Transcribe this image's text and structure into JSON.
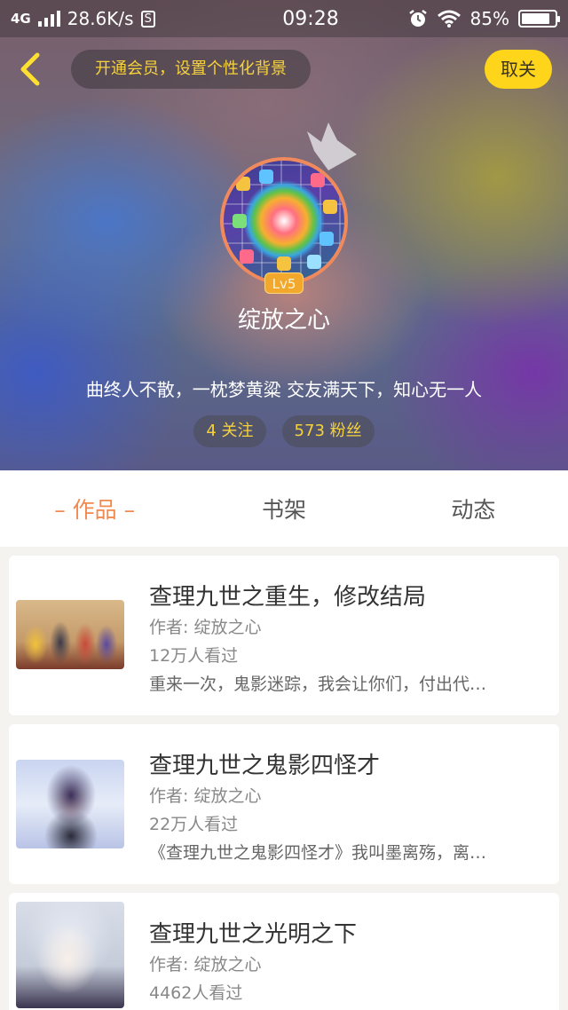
{
  "status_bar": {
    "network": "4G",
    "speed": "28.6K/s",
    "s_badge": "S",
    "time": "09:28",
    "battery_pct": "85%",
    "battery_level": 0.85
  },
  "header": {
    "vip_banner": "开通会员，设置个性化背景",
    "unfollow_label": "取关"
  },
  "profile": {
    "level": "Lv5",
    "nickname": "绽放之心",
    "signature": "曲终人不散，一枕梦黄粱 交友满天下，知心无一人",
    "following": "4 关注",
    "fans": "573 粉丝"
  },
  "tabs": [
    {
      "label": "– 作品 –",
      "active": true
    },
    {
      "label": "书架",
      "active": false
    },
    {
      "label": "动态",
      "active": false
    }
  ],
  "works": [
    {
      "title": "查理九世之重生，修改结局",
      "author": "作者: 绽放之心",
      "views": "12万人看过",
      "desc": "重来一次，鬼影迷踪，我会让你们，付出代…"
    },
    {
      "title": "查理九世之鬼影四怪才",
      "author": "作者: 绽放之心",
      "views": "22万人看过",
      "desc": "《查理九世之鬼影四怪才》我叫墨离殇，离…"
    },
    {
      "title": "查理九世之光明之下",
      "author": "作者: 绽放之心",
      "views": "4462人看过",
      "desc": ""
    }
  ],
  "colors": {
    "accent_yellow": "#ffd51c",
    "accent_orange": "#f08a50",
    "banner_text": "#f7d23b"
  }
}
